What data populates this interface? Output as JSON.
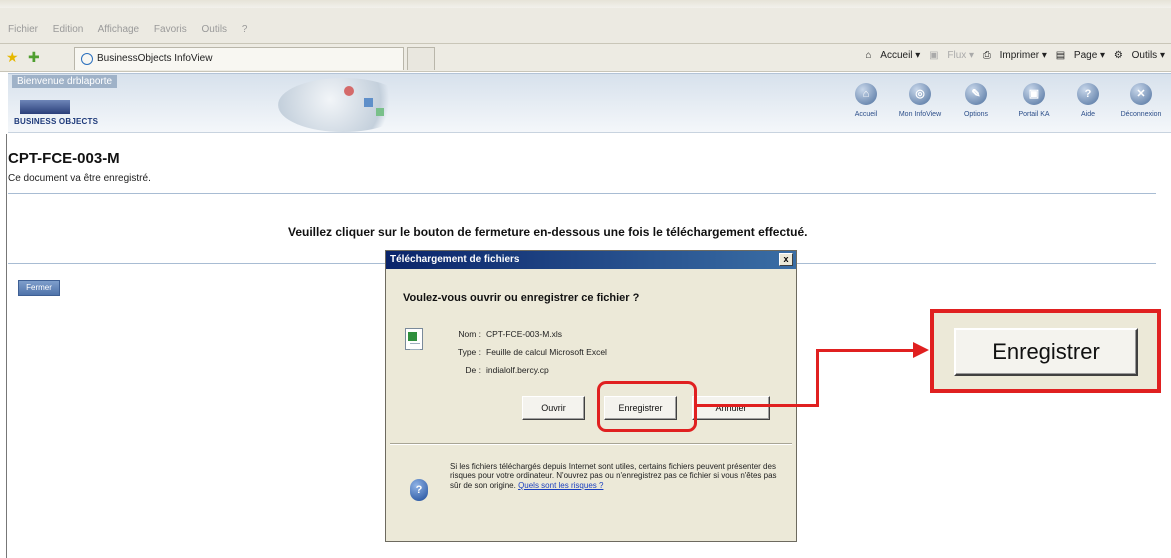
{
  "browser": {
    "menu": [
      "Fichier",
      "Edition",
      "Affichage",
      "Favoris",
      "Outils",
      "?"
    ],
    "tab_title": "BusinessObjects InfoView",
    "commands": {
      "home": "Accueil",
      "feeds": "Flux",
      "print": "Imprimer",
      "page": "Page",
      "tools": "Outils"
    }
  },
  "header": {
    "welcome": "Bienvenue drblaporte",
    "logo": "BUSINESS OBJECTS",
    "nav": [
      {
        "label": "Accueil",
        "icon": "home-icon"
      },
      {
        "label": "Mon InfoView",
        "icon": "my-infoview-icon"
      },
      {
        "label": "Options",
        "icon": "options-icon"
      },
      {
        "label": "Portail KA",
        "icon": "portal-icon"
      },
      {
        "label": "Aide",
        "icon": "help-icon"
      },
      {
        "label": "Déconnexion",
        "icon": "logout-icon"
      }
    ]
  },
  "page": {
    "title": "CPT-FCE-003-M",
    "subtitle": "Ce document va être enregistré.",
    "instruction": "Veuillez cliquer sur le bouton de fermeture en-dessous une fois le téléchargement effectué.",
    "close_button": "Fermer"
  },
  "dialog": {
    "title": "Téléchargement de fichiers",
    "close": "x",
    "question": "Voulez-vous ouvrir ou enregistrer ce fichier ?",
    "fields": {
      "name_label": "Nom :",
      "name_value": "CPT-FCE-003-M.xls",
      "type_label": "Type :",
      "type_value": "Feuille de calcul Microsoft Excel",
      "from_label": "De :",
      "from_value": "indialolf.bercy.cp"
    },
    "buttons": {
      "open": "Ouvrir",
      "save": "Enregistrer",
      "cancel": "Annuler"
    },
    "warning_text": "Si les fichiers téléchargés depuis Internet sont utiles, certains fichiers peuvent présenter des risques pour votre ordinateur. N'ouvrez pas ou n'enregistrez pas ce fichier si vous n'êtes pas sûr de son origine.",
    "warning_link": "Quels sont les risques ?"
  },
  "callout": {
    "zoom_label": "Enregistrer",
    "accent_color": "#e02020"
  }
}
